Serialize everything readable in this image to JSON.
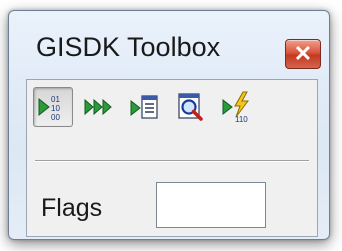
{
  "window": {
    "title": "GISDK Toolbox",
    "close_glyph": "✕"
  },
  "toolbar": {
    "tools": [
      {
        "icon": "run-binary-icon",
        "pressed": true
      },
      {
        "icon": "fast-forward-icon",
        "pressed": false
      },
      {
        "icon": "run-to-document-icon",
        "pressed": false
      },
      {
        "icon": "magnify-search-icon",
        "pressed": false
      },
      {
        "icon": "run-lightning-binary-icon",
        "pressed": false
      }
    ]
  },
  "flags": {
    "label": "Flags",
    "value": ""
  },
  "colors": {
    "arrow_green": "#2a9a3a",
    "close_red": "#d0472f"
  }
}
